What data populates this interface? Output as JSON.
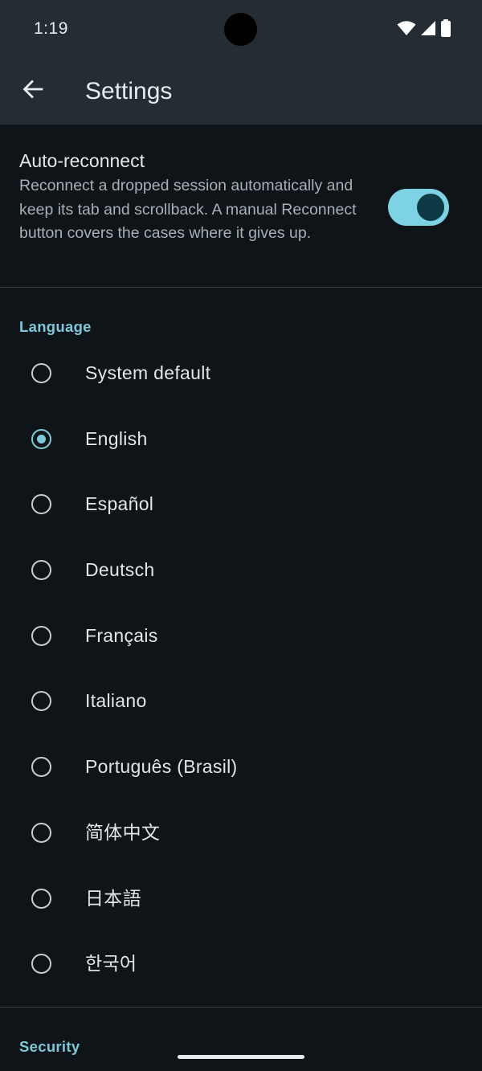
{
  "status_bar": {
    "time": "1:19",
    "icons": [
      "wifi-icon",
      "cellular-signal-icon",
      "battery-icon"
    ]
  },
  "app_bar": {
    "back_icon": "arrow-back-icon",
    "title": "Settings"
  },
  "auto_reconnect": {
    "title": "Auto-reconnect",
    "description": "Reconnect a dropped session automatically and keep its tab and scrollback. A manual Reconnect button covers the cases where it gives up.",
    "enabled": true
  },
  "language": {
    "header": "Language",
    "selected": "English",
    "options": [
      {
        "label": "System default",
        "checked": false
      },
      {
        "label": "English",
        "checked": true
      },
      {
        "label": "Español",
        "checked": false
      },
      {
        "label": "Deutsch",
        "checked": false
      },
      {
        "label": "Français",
        "checked": false
      },
      {
        "label": "Italiano",
        "checked": false
      },
      {
        "label": "Português (Brasil)",
        "checked": false
      },
      {
        "label": "简体中文",
        "checked": false
      },
      {
        "label": "日本語",
        "checked": false
      },
      {
        "label": "한국어",
        "checked": false
      }
    ]
  },
  "security": {
    "header": "Security"
  },
  "colors": {
    "accent": "#7cc8d9",
    "toggle_track": "#7dd3e4",
    "background": "#0f1418",
    "appbar": "#232d33"
  }
}
